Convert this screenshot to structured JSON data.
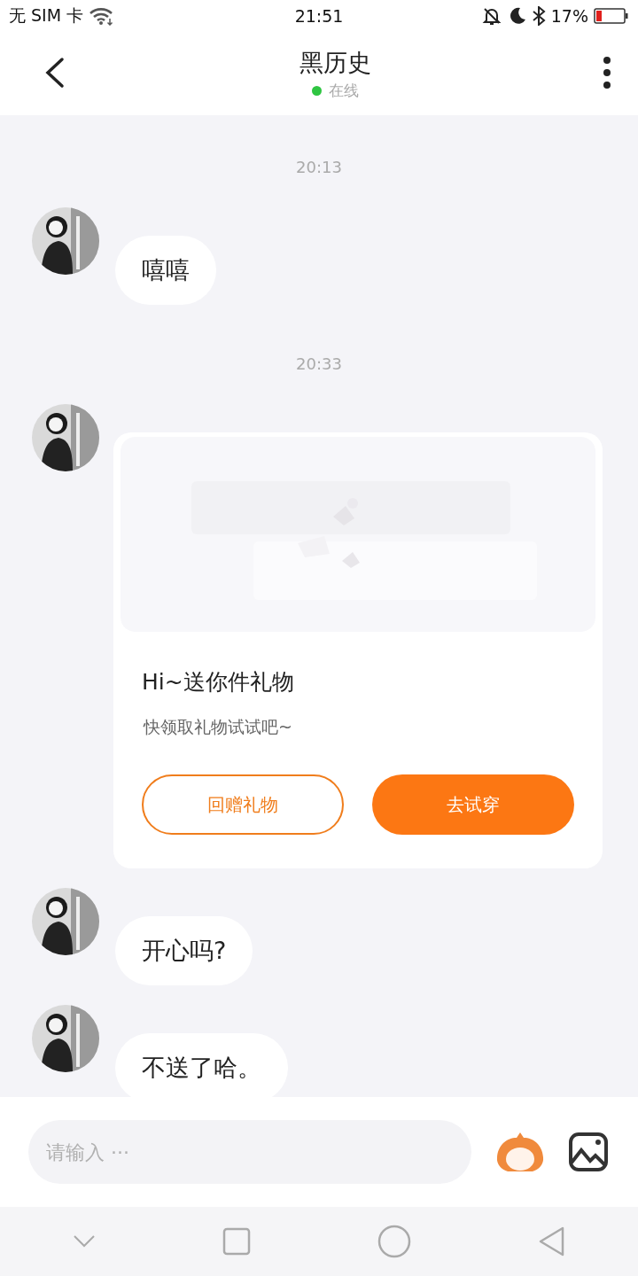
{
  "status_bar": {
    "carrier": "无 SIM 卡",
    "time": "21:51",
    "battery": "17%"
  },
  "header": {
    "title": "黑历史",
    "status": "在线",
    "online": true
  },
  "messages": [
    {
      "kind": "time",
      "text": "20:13"
    },
    {
      "kind": "text",
      "text": "嘻嘻"
    },
    {
      "kind": "time",
      "text": "20:33"
    },
    {
      "kind": "gift_card",
      "title": "Hi~送你件礼物",
      "subtitle": "快领取礼物试试吧~",
      "buttons": [
        {
          "label": "回赠礼物",
          "kind": "outline"
        },
        {
          "label": "去试穿",
          "kind": "filled"
        }
      ]
    },
    {
      "kind": "text",
      "text": "开心吗?"
    },
    {
      "kind": "text",
      "text": "不送了哈。"
    }
  ],
  "input": {
    "placeholder": "请输入 ···"
  }
}
